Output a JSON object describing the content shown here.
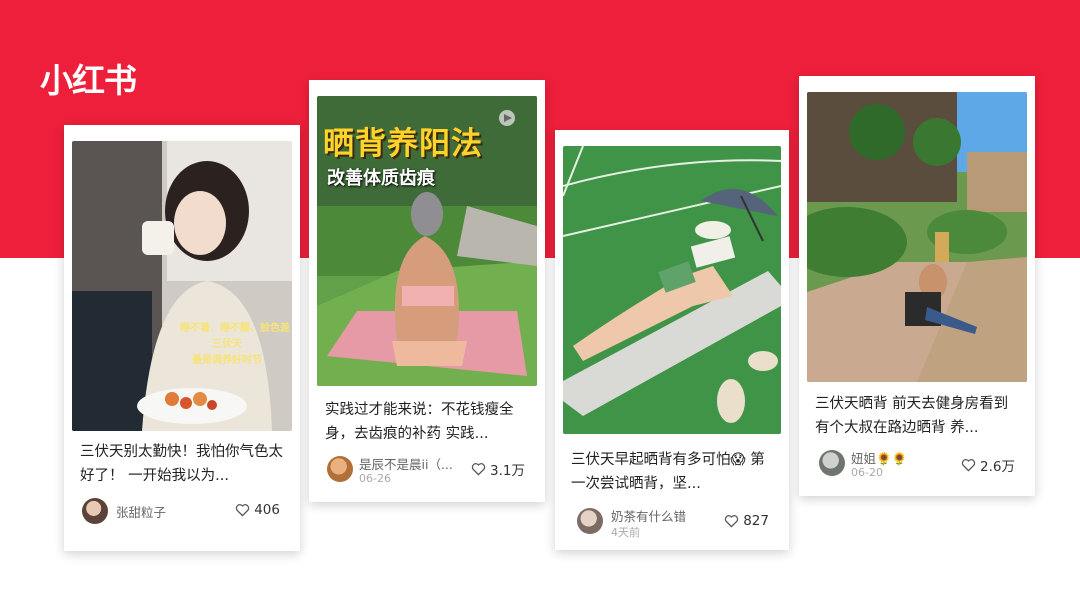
{
  "brand": {
    "logo_text": "小红书",
    "banner_color": "#ee1f3b"
  },
  "posts": [
    {
      "title": "三伏天别太勤快！我怕你气色太好了！ 一开始我以为...",
      "author": "张甜粒子",
      "date": "",
      "likes": "406",
      "overlay_lines": [
        "睡不着、睡不醒、脸色差",
        "三伏天",
        "最是调养好时节"
      ]
    },
    {
      "title": "实践过才能来说：不花钱瘦全身，去齿痕的补药 实践...",
      "author": "是辰不是晨ii（...",
      "date": "06-26",
      "likes": "3.1万",
      "overlay_title": "晒背养阳法",
      "overlay_subtitle": "改善体质齿痕"
    },
    {
      "title": "三伏天早起晒背有多可怕😱 第一次尝试晒背，坚...",
      "author": "奶茶有什么错",
      "date": "4天前",
      "likes": "827"
    },
    {
      "title": "三伏天晒背 前天去健身房看到有个大叔在路边晒背 养...",
      "author": "妞姐🌻🌻",
      "date": "06-20",
      "likes": "2.6万"
    }
  ]
}
